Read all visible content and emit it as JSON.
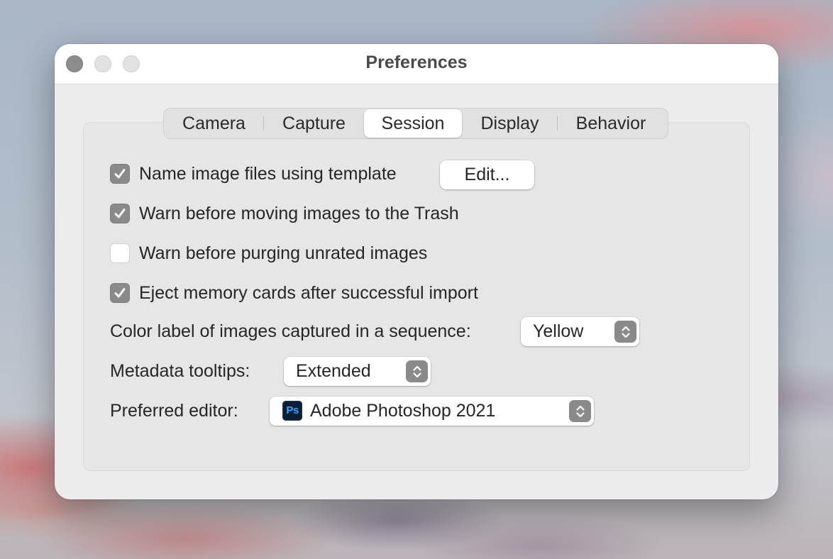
{
  "window": {
    "title": "Preferences"
  },
  "tabs": [
    {
      "label": "Camera",
      "selected": false
    },
    {
      "label": "Capture",
      "selected": false
    },
    {
      "label": "Session",
      "selected": true
    },
    {
      "label": "Display",
      "selected": false
    },
    {
      "label": "Behavior",
      "selected": false
    }
  ],
  "options": {
    "name_template": {
      "label": "Name image files using template",
      "checked": true,
      "button_label": "Edit..."
    },
    "warn_trash": {
      "label": "Warn before moving images to the Trash",
      "checked": true
    },
    "warn_purge": {
      "label": "Warn before purging unrated images",
      "checked": false
    },
    "eject_cards": {
      "label": "Eject memory cards after successful import",
      "checked": true
    }
  },
  "color_label": {
    "label": "Color label of images captured in a sequence:",
    "value": "Yellow"
  },
  "metadata_tooltips": {
    "label": "Metadata tooltips:",
    "value": "Extended"
  },
  "preferred_editor": {
    "label": "Preferred editor:",
    "value": "Adobe Photoshop 2021",
    "icon_text": "Ps"
  },
  "icons": {
    "checkmark": "checkmark-icon",
    "stepper": "up-down-chevron-icon",
    "app": "photoshop-app-icon"
  },
  "colors": {
    "checkbox_checked": "#8a8a8a",
    "window_bg": "#ececec",
    "ps_icon_bg": "#0b1e35",
    "ps_icon_fg": "#31a8ff"
  }
}
